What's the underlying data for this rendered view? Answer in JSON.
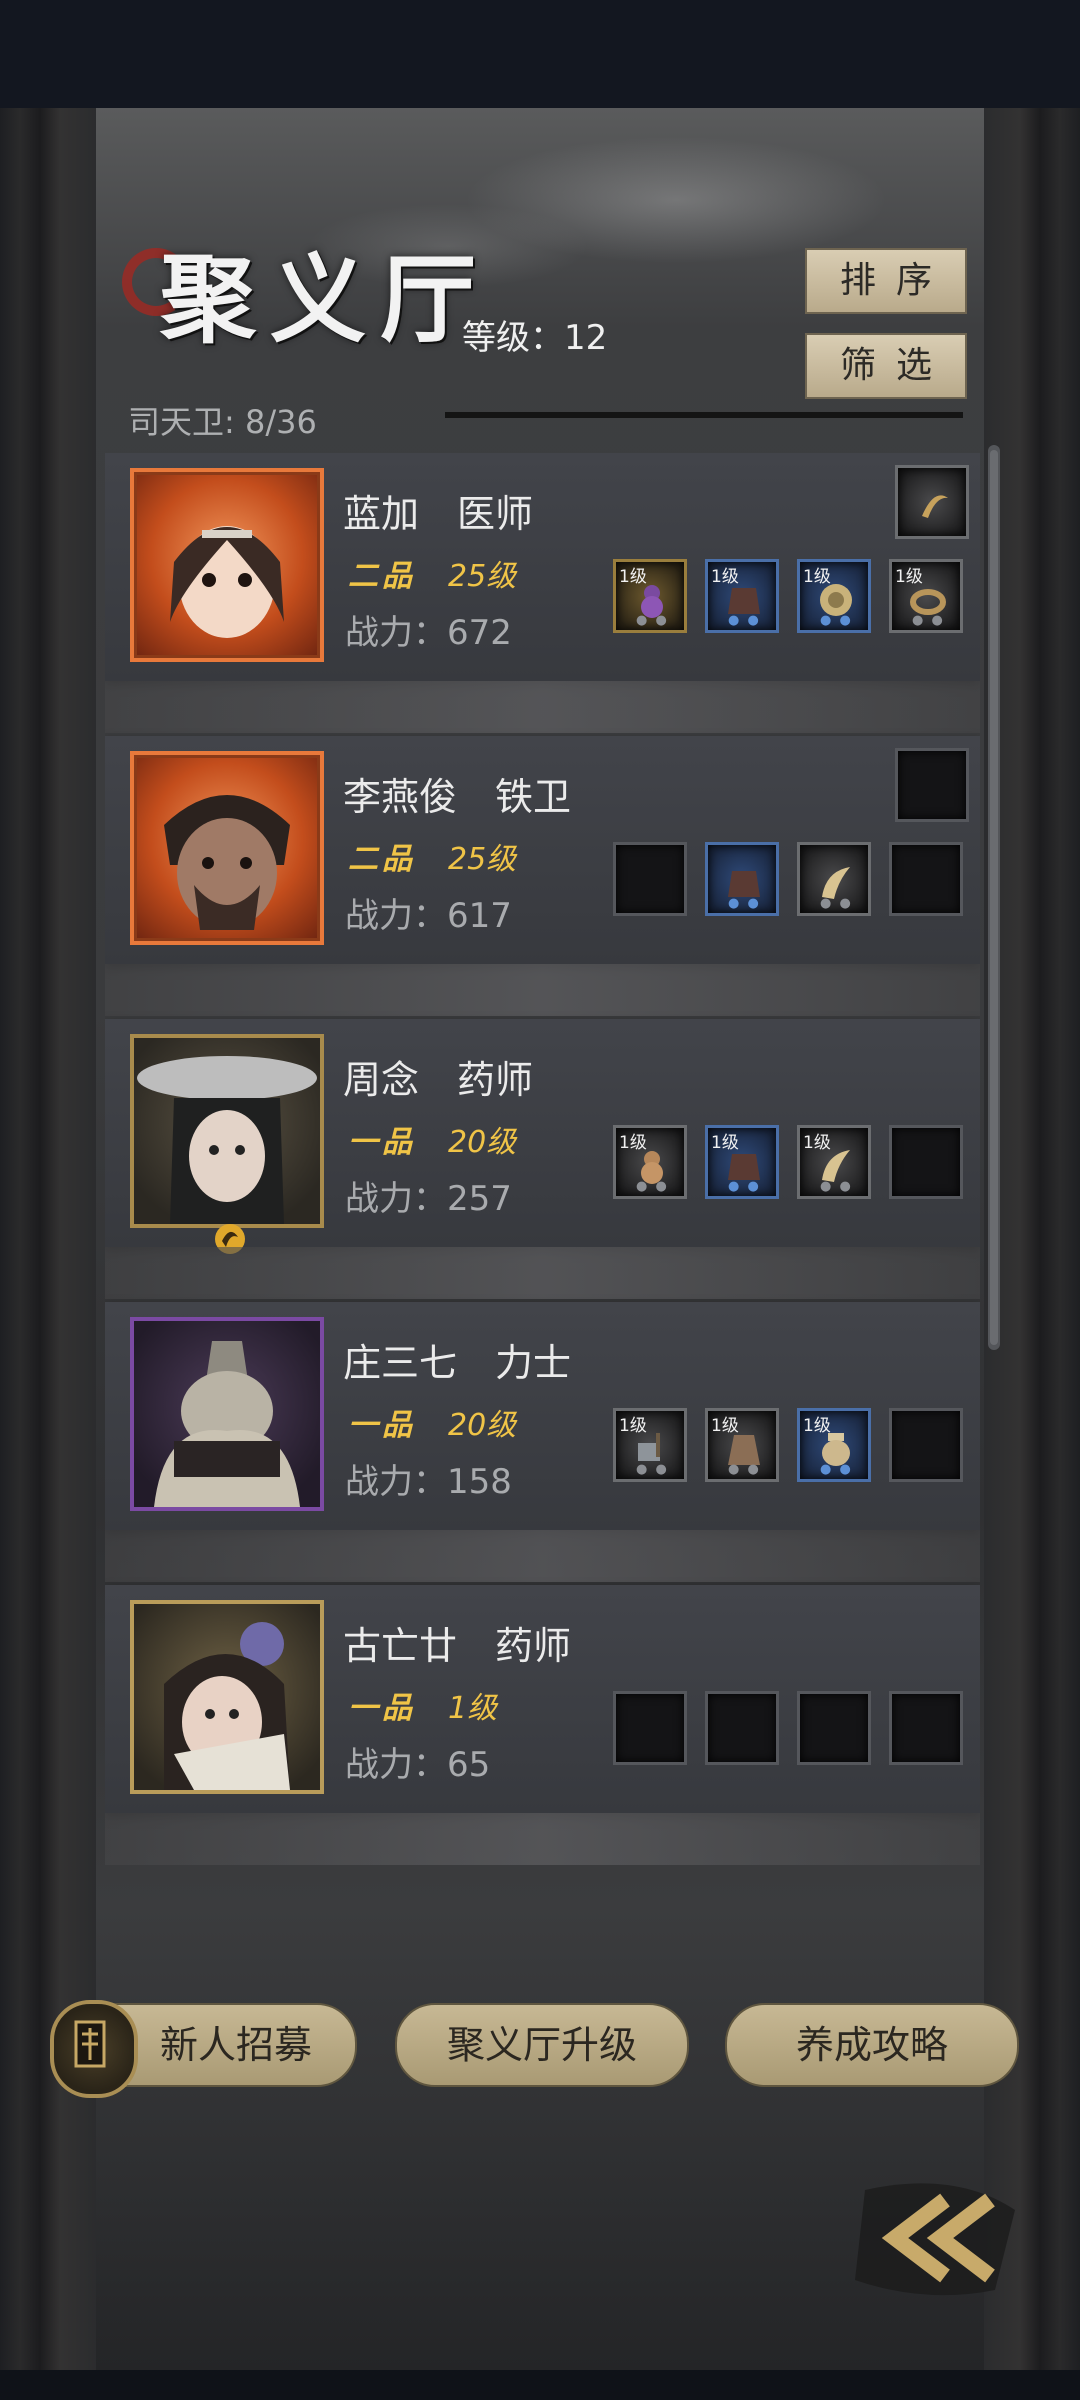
{
  "header": {
    "title": "聚义厅",
    "level_label": "等级：12",
    "guard_count": "司天卫: 8/36",
    "sort_label": "排序",
    "filter_label": "筛选"
  },
  "characters": [
    {
      "name": "蓝加　医师",
      "rank": "二品",
      "level": "25级",
      "power": "战力：672",
      "frame_color": "#e8793b",
      "equipment": [
        {
          "level": "1级",
          "icon": "gourd-icon",
          "rarity": "gold"
        },
        {
          "level": "1级",
          "icon": "armor-icon",
          "rarity": "blue"
        },
        {
          "level": "1级",
          "icon": "medallion-icon",
          "rarity": "blue"
        },
        {
          "level": "1级",
          "icon": "ring-icon",
          "rarity": "gray"
        }
      ],
      "top_slot_icon": "crescent-amulet-icon"
    },
    {
      "name": "李燕俊　铁卫",
      "rank": "二品",
      "level": "25级",
      "power": "战力：617",
      "frame_color": "#e8793b",
      "equipment": [
        {
          "level": "",
          "icon": "empty-slot-icon",
          "rarity": "empty"
        },
        {
          "level": "",
          "icon": "armor-icon",
          "rarity": "blue"
        },
        {
          "level": "",
          "icon": "horn-icon",
          "rarity": "gray"
        },
        {
          "level": "",
          "icon": "empty-slot-icon",
          "rarity": "empty"
        }
      ],
      "top_slot_icon": "empty-slot-icon"
    },
    {
      "name": "周念　药师",
      "rank": "一品",
      "level": "20级",
      "power": "战力：257",
      "frame_color": "#a88b4c",
      "equipment": [
        {
          "level": "1级",
          "icon": "gourd-icon",
          "rarity": "gray"
        },
        {
          "level": "1级",
          "icon": "armor-icon",
          "rarity": "blue"
        },
        {
          "level": "1级",
          "icon": "horn-icon",
          "rarity": "gray"
        },
        {
          "level": "",
          "icon": "empty-slot-icon",
          "rarity": "empty"
        }
      ]
    },
    {
      "name": "庄三七　力士",
      "rank": "一品",
      "level": "20级",
      "power": "战力：158",
      "frame_color": "#7b4aa3",
      "equipment": [
        {
          "level": "1级",
          "icon": "hammer-icon",
          "rarity": "gray"
        },
        {
          "level": "1级",
          "icon": "robe-icon",
          "rarity": "gray"
        },
        {
          "level": "1级",
          "icon": "pot-icon",
          "rarity": "blue"
        },
        {
          "level": "",
          "icon": "empty-slot-icon",
          "rarity": "empty"
        }
      ]
    },
    {
      "name": "古亡廿　药师",
      "rank": "一品",
      "level": "1级",
      "power": "战力：65",
      "frame_color": "#b99c5a",
      "equipment": [
        {
          "level": "",
          "icon": "empty-slot-icon",
          "rarity": "empty"
        },
        {
          "level": "",
          "icon": "empty-slot-icon",
          "rarity": "empty"
        },
        {
          "level": "",
          "icon": "empty-slot-icon",
          "rarity": "empty"
        },
        {
          "level": "",
          "icon": "empty-slot-icon",
          "rarity": "empty"
        }
      ]
    }
  ],
  "bottom_buttons": {
    "recruit": "新人招募",
    "upgrade": "聚义厅升级",
    "guide": "养成攻略"
  }
}
